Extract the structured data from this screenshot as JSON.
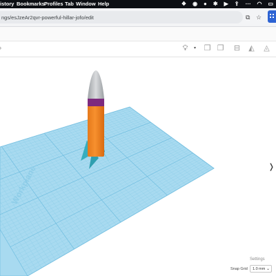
{
  "menubar": {
    "items": [
      "istory",
      "Bookmarks",
      "Profiles",
      "Tab",
      "Window",
      "Help"
    ],
    "icons": [
      "dropbox-icon",
      "record-icon",
      "github-icon",
      "bluetooth-icon",
      "play-icon",
      "upload-icon",
      "more-icon",
      "wifi-icon",
      "battery-icon"
    ]
  },
  "browser": {
    "url": "ngs/esJzeAr2qvr-powerful-hillar-jofo/edit"
  },
  "workplane": {
    "label": "Workplane",
    "color": "#a8daf0",
    "grid_color": "#7fc4e3"
  },
  "rocket": {
    "body_color": "#f7902e",
    "band_color": "#7d2a7e",
    "nose_color": "#c6c9cc",
    "fin_color": "#35aebf"
  },
  "footer": {
    "settings_label": "Settings",
    "snap_label": "Snap Grid",
    "snap_value": "1.0 mm"
  }
}
